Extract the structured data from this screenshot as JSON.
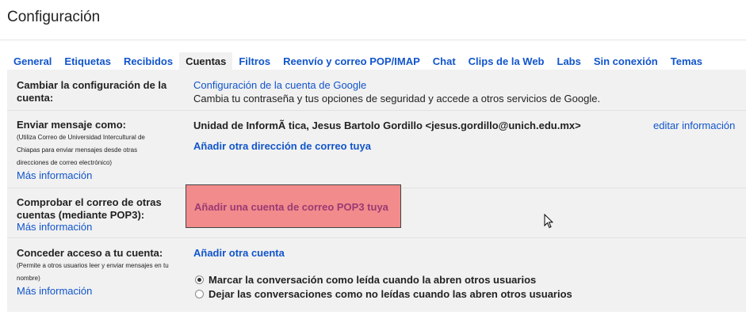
{
  "page": {
    "title": "Configuración"
  },
  "tabs": [
    "General",
    "Etiquetas",
    "Recibidos",
    "Cuentas",
    "Filtros",
    "Reenvío y correo POP/IMAP",
    "Chat",
    "Clips de la Web",
    "Labs",
    "Sin conexión",
    "Temas"
  ],
  "active_tab": "Cuentas",
  "rows": {
    "change_account": {
      "label": "Cambiar la configuración de la cuenta:",
      "link": "Configuración de la cuenta de Google",
      "description": "Cambia tu contraseña y tus opciones de seguridad y accede a otros servicios de Google."
    },
    "send_as": {
      "label": "Enviar mensaje como:",
      "help": "(Utiliza Correo de Universidad Intercultural de Chiapas para enviar mensajes desde otras direcciones de correo electrónico)",
      "more": "Más información",
      "identity": "Unidad de InformÃ tica, Jesus Bartolo Gordillo <jesus.gordillo@unich.edu.mx>",
      "edit": "editar información",
      "add": "Añadir otra dirección de correo tuya"
    },
    "pop3": {
      "label": "Comprobar el correo de otras cuentas (mediante POP3):",
      "more": "Más información",
      "add": "Añadir una cuenta de correo POP3 tuya"
    },
    "grant": {
      "label": "Conceder acceso a tu cuenta:",
      "help": "(Permite a otros usuarios leer y enviar mensajes en tu nombre)",
      "more": "Más información",
      "add": "Añadir otra cuenta",
      "option_read": "Marcar la conversación como leída cuando la abren otros usuarios",
      "option_unread": "Dejar las conversaciones como no leídas cuando las abren otros usuarios",
      "selected": "option_read"
    }
  },
  "colors": {
    "link": "#1155cc",
    "highlight": "#f28b8b",
    "panel": "#f1f1f1"
  }
}
